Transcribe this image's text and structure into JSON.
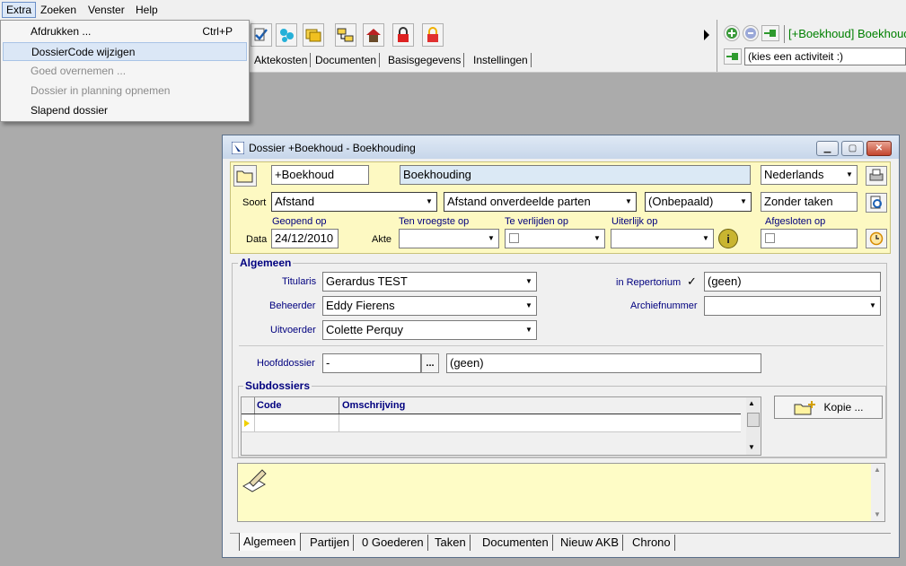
{
  "menubar": {
    "items": [
      {
        "label": "Extra"
      },
      {
        "label": "Zoeken"
      },
      {
        "label": "Venster"
      },
      {
        "label": "Help"
      }
    ]
  },
  "extra_menu": {
    "items": [
      {
        "label": "Afdrukken ...",
        "shortcut": "Ctrl+P",
        "state": "normal"
      },
      {
        "label": "DossierCode wijzigen",
        "shortcut": "",
        "state": "highlighted"
      },
      {
        "label": "Goed overnemen ...",
        "shortcut": "",
        "state": "disabled"
      },
      {
        "label": "Dossier in planning opnemen",
        "shortcut": "",
        "state": "disabled"
      },
      {
        "label": "Slapend dossier",
        "shortcut": "",
        "state": "normal"
      }
    ]
  },
  "toolbar": {
    "top_tabs": [
      "Aktekosten",
      "Documenten",
      "Basisgegevens",
      "Instellingen"
    ],
    "active_dossier": "[+Boekhoud] Boekhoud",
    "activity_placeholder": "(kies een activiteit :)"
  },
  "window": {
    "title": "Dossier +Boekhoud - Boekhouding",
    "header": {
      "code": "+Boekhoud",
      "description": "Boekhouding",
      "language": "Nederlands",
      "soort_label": "Soort",
      "soort": "Afstand",
      "soort_detail": "Afstand onverdeelde parten",
      "onbepaald": "(Onbepaald)",
      "taken": "Zonder taken",
      "data_label": "Data",
      "geopend_label": "Geopend op",
      "geopend": "24/12/2010",
      "akte_label": "Akte",
      "ten_vroegste_label": "Ten vroegste op",
      "te_verlijden_label": "Te verlijden op",
      "uiterlijk_label": "Uiterlijk op",
      "afgesloten_label": "Afgesloten op"
    },
    "algemeen": {
      "title": "Algemeen",
      "titularis_label": "Titularis",
      "titularis": "Gerardus TEST",
      "beheerder_label": "Beheerder",
      "beheerder": "Eddy Fierens",
      "uitvoerder_label": "Uitvoerder",
      "uitvoerder": "Colette Perquy",
      "repertorium_label": "in Repertorium",
      "repertorium": "(geen)",
      "archief_label": "Archiefnummer",
      "archief": "",
      "hoofddossier_label": "Hoofddossier",
      "hoofddossier": "-",
      "hoofddossier_desc": "(geen)",
      "browse": "..."
    },
    "subdossiers": {
      "title": "Subdossiers",
      "columns": [
        "Code",
        "Omschrijving"
      ],
      "kopie_label": "Kopie ..."
    },
    "bottom_tabs": [
      "Algemeen",
      "Partijen",
      "0 Goederen",
      "Taken",
      "Documenten",
      "Nieuw AKB",
      "Chrono"
    ]
  },
  "colors": {
    "header_bg": "#fdf9c2",
    "notes_bg": "#fefcc6",
    "label_blue": "#00007f",
    "active_dossier_green": "#008000"
  }
}
